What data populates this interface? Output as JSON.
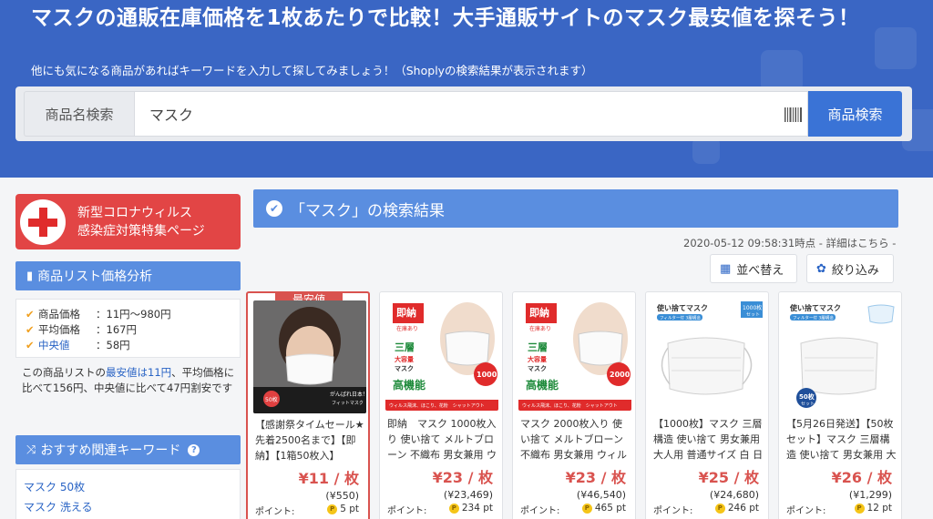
{
  "hero": {
    "title": "マスクの通販在庫価格を1枚あたりで比較！大手通販サイトのマスク最安値を探そう！",
    "subtitle": "他にも気になる商品があればキーワードを入力して探してみましょう！（Shoplyの検索結果が表示されます）"
  },
  "search": {
    "label": "商品名検索",
    "value": "マスク",
    "button": "商品検索",
    "barcode_icon": "barcode-icon"
  },
  "sidebar": {
    "corona_line1": "新型コロナウィルス",
    "corona_line2": "感染症対策特集ページ",
    "analysis_title": "商品リスト価格分析",
    "stats": [
      {
        "key": "商品価格",
        "sep": "：",
        "value": "11円〜980円",
        "highlight": false
      },
      {
        "key": "平均価格",
        "sep": "：",
        "value": "167円",
        "highlight": false
      },
      {
        "key": "中央値",
        "sep": "：",
        "value": "58円",
        "highlight": true
      }
    ],
    "analysis_pre": "この商品リストの",
    "analysis_hl": "最安値は11円",
    "analysis_post": "、平均価格に比べて156円、中央値に比べて47円割安です",
    "keywords_title": "おすすめ関連キーワード",
    "keywords": [
      "マスク 50枚",
      "マスク 洗える"
    ]
  },
  "results": {
    "title": "「マスク」の検索結果",
    "timestamp": "2020-05-12 09:58:31時点 - 詳細はこちら -",
    "sort_label": "並べ替え",
    "filter_label": "絞り込み",
    "best_badge": "最安値",
    "point_label": "ポイント:",
    "products": [
      {
        "title": "【感謝祭タイムセール★先着2500名まで】【即納】【1箱50枚入】",
        "price": "¥11 / 枚",
        "total": "(¥550)",
        "points": "5 pt"
      },
      {
        "title": "即納　マスク 1000枚入り 使い捨て メルトブローン 不織布 男女兼用 ウ",
        "price": "¥23 / 枚",
        "total": "(¥23,469)",
        "points": "234 pt"
      },
      {
        "title": "マスク 2000枚入り 使い捨て メルトブローン 不織布 男女兼用 ウィルス",
        "price": "¥23 / 枚",
        "total": "(¥46,540)",
        "points": "465 pt"
      },
      {
        "title": "【1000枚】マスク 三層構造 使い捨て 男女兼用 大人用 普通サイズ 白 日",
        "price": "¥25 / 枚",
        "total": "(¥24,680)",
        "points": "246 pt"
      },
      {
        "title": "【5月26日発送】【50枚セット】マスク 三層構造 使い捨て 男女兼用 大",
        "price": "¥26 / 枚",
        "total": "(¥1,299)",
        "points": "12 pt"
      }
    ],
    "image_text": {
      "sokuno": "即納",
      "zaiko": "在庫あり",
      "sanso": "三層",
      "daiyoryo": "大容量",
      "mask": "マスク",
      "kokino": "高機能",
      "melt": "メルトブローン不織布",
      "virus": "ウィルス飛沫、ほこり、花粉　シャットアウト",
      "count1000": "1000",
      "count2000": "2000",
      "iri": "入り",
      "tsukaisute": "使い捨てマスク",
      "filter3": "フィルター付 3層構造",
      "set1000": "1000枚",
      "set50": "50枚",
      "set": "セット",
      "ganbare": "がんばれ日本！",
      "fit": "フィットマスク",
      "fifty": "50枚"
    }
  },
  "colors": {
    "hero_bg": "#3a66c4",
    "accent": "#5a8ee0",
    "price_red": "#d9534f",
    "link_blue": "#2a64c5"
  }
}
